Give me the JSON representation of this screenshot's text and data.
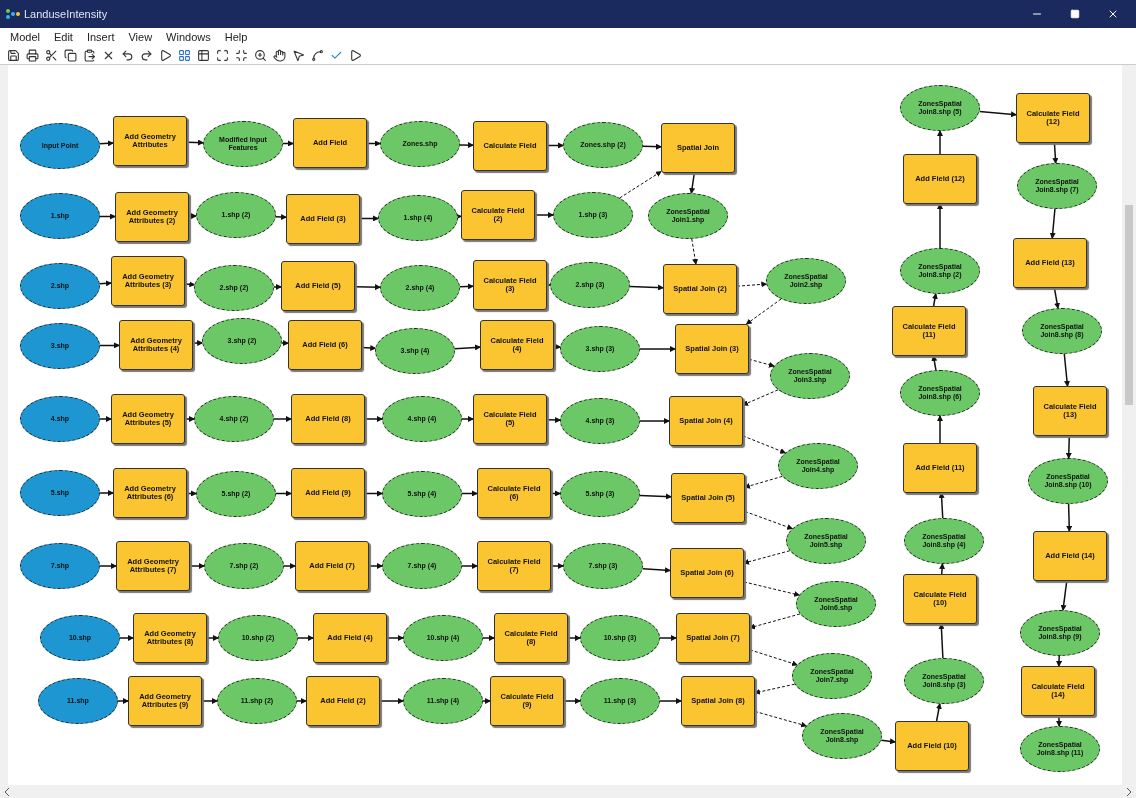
{
  "window": {
    "title": "LanduseIntensity"
  },
  "menu": [
    "Model",
    "Edit",
    "Insert",
    "View",
    "Windows",
    "Help"
  ],
  "canvas": {
    "rows": [
      {
        "nodes": [
          {
            "kind": "input",
            "label": "Input Point"
          },
          {
            "kind": "tool",
            "label": "Add Geometry Attributes"
          },
          {
            "kind": "output",
            "label": "Modified Input Features"
          },
          {
            "kind": "tool",
            "label": "Add Field"
          },
          {
            "kind": "output",
            "label": "Zones.shp"
          },
          {
            "kind": "tool",
            "label": "Calculate Field"
          },
          {
            "kind": "output",
            "label": "Zones.shp (2)"
          },
          {
            "kind": "tool",
            "label": "Spatial Join"
          }
        ]
      },
      {
        "nodes": [
          {
            "kind": "input",
            "label": "1.shp"
          },
          {
            "kind": "tool",
            "label": "Add Geometry Attributes (2)"
          },
          {
            "kind": "output",
            "label": "1.shp (2)"
          },
          {
            "kind": "tool",
            "label": "Add Field (3)"
          },
          {
            "kind": "output",
            "label": "1.shp (4)"
          },
          {
            "kind": "tool",
            "label": "Calculate Field (2)"
          },
          {
            "kind": "output",
            "label": "1.shp (3)"
          },
          {
            "kind": "output",
            "label": "ZonesSpatial Join1.shp"
          }
        ]
      },
      {
        "nodes": [
          {
            "kind": "input",
            "label": "2.shp"
          },
          {
            "kind": "tool",
            "label": "Add Geometry Attributes (3)"
          },
          {
            "kind": "output",
            "label": "2.shp (2)"
          },
          {
            "kind": "tool",
            "label": "Add Field (5)"
          },
          {
            "kind": "output",
            "label": "2.shp (4)"
          },
          {
            "kind": "tool",
            "label": "Calculate Field (3)"
          },
          {
            "kind": "output",
            "label": "2.shp (3)"
          },
          {
            "kind": "tool",
            "label": "Spatial Join (2)"
          },
          {
            "kind": "output",
            "label": "ZonesSpatial Join2.shp"
          }
        ]
      },
      {
        "nodes": [
          {
            "kind": "input",
            "label": "3.shp"
          },
          {
            "kind": "tool",
            "label": "Add Geometry Attributes (4)"
          },
          {
            "kind": "output",
            "label": "3.shp (2)"
          },
          {
            "kind": "tool",
            "label": "Add Field (6)"
          },
          {
            "kind": "output",
            "label": "3.shp (4)"
          },
          {
            "kind": "tool",
            "label": "Calculate Field (4)"
          },
          {
            "kind": "output",
            "label": "3.shp (3)"
          },
          {
            "kind": "tool",
            "label": "Spatial Join (3)"
          },
          {
            "kind": "output",
            "label": "ZonesSpatial Join3.shp"
          }
        ]
      },
      {
        "nodes": [
          {
            "kind": "input",
            "label": "4.shp"
          },
          {
            "kind": "tool",
            "label": "Add Geometry Attributes (5)"
          },
          {
            "kind": "output",
            "label": "4.shp (2)"
          },
          {
            "kind": "tool",
            "label": "Add Field (8)"
          },
          {
            "kind": "output",
            "label": "4.shp (4)"
          },
          {
            "kind": "tool",
            "label": "Calculate Field (5)"
          },
          {
            "kind": "output",
            "label": "4.shp (3)"
          },
          {
            "kind": "tool",
            "label": "Spatial Join (4)"
          },
          {
            "kind": "output",
            "label": "ZonesSpatial Join4.shp"
          }
        ]
      },
      {
        "nodes": [
          {
            "kind": "input",
            "label": "5.shp"
          },
          {
            "kind": "tool",
            "label": "Add Geometry Attributes (6)"
          },
          {
            "kind": "output",
            "label": "5.shp (2)"
          },
          {
            "kind": "tool",
            "label": "Add Field (9)"
          },
          {
            "kind": "output",
            "label": "5.shp (4)"
          },
          {
            "kind": "tool",
            "label": "Calculate Field (6)"
          },
          {
            "kind": "output",
            "label": "5.shp (3)"
          },
          {
            "kind": "tool",
            "label": "Spatial Join (5)"
          },
          {
            "kind": "output",
            "label": "ZonesSpatial Join5.shp"
          }
        ]
      },
      {
        "nodes": [
          {
            "kind": "input",
            "label": "7.shp"
          },
          {
            "kind": "tool",
            "label": "Add Geometry Attributes (7)"
          },
          {
            "kind": "output",
            "label": "7.shp (2)"
          },
          {
            "kind": "tool",
            "label": "Add Field (7)"
          },
          {
            "kind": "output",
            "label": "7.shp (4)"
          },
          {
            "kind": "tool",
            "label": "Calculate Field (7)"
          },
          {
            "kind": "output",
            "label": "7.shp (3)"
          },
          {
            "kind": "tool",
            "label": "Spatial Join (6)"
          },
          {
            "kind": "output",
            "label": "ZonesSpatial Join6.shp"
          }
        ]
      },
      {
        "nodes": [
          {
            "kind": "input",
            "label": "10.shp"
          },
          {
            "kind": "tool",
            "label": "Add Geometry Attributes (8)"
          },
          {
            "kind": "output",
            "label": "10.shp (2)"
          },
          {
            "kind": "tool",
            "label": "Add Field (4)"
          },
          {
            "kind": "output",
            "label": "10.shp (4)"
          },
          {
            "kind": "tool",
            "label": "Calculate Field (8)"
          },
          {
            "kind": "output",
            "label": "10.shp (3)"
          },
          {
            "kind": "tool",
            "label": "Spatial Join (7)"
          },
          {
            "kind": "output",
            "label": "ZonesSpatial Join7.shp"
          }
        ]
      },
      {
        "nodes": [
          {
            "kind": "input",
            "label": "11.shp"
          },
          {
            "kind": "tool",
            "label": "Add Geometry Attributes (9)"
          },
          {
            "kind": "output",
            "label": "11.shp (2)"
          },
          {
            "kind": "tool",
            "label": "Add Field (2)"
          },
          {
            "kind": "output",
            "label": "11.shp (4)"
          },
          {
            "kind": "tool",
            "label": "Calculate Field (9)"
          },
          {
            "kind": "output",
            "label": "11.shp (3)"
          },
          {
            "kind": "tool",
            "label": "Spatial Join (8)"
          },
          {
            "kind": "output",
            "label": "ZonesSpatial Join8.shp"
          }
        ]
      }
    ],
    "columns": [
      {
        "nodes": [
          {
            "kind": "output",
            "label": "ZonesSpatial Join8.shp (5)"
          },
          {
            "kind": "tool",
            "label": "Add Field (12)"
          },
          {
            "kind": "output",
            "label": "ZonesSpatial Join8.shp (2)"
          },
          {
            "kind": "tool",
            "label": "Calculate Field (11)"
          },
          {
            "kind": "output",
            "label": "ZonesSpatial Join8.shp (6)"
          },
          {
            "kind": "tool",
            "label": "Add Field (11)"
          },
          {
            "kind": "output",
            "label": "ZonesSpatial Join8.shp (4)"
          },
          {
            "kind": "tool",
            "label": "Calculate Field (10)"
          },
          {
            "kind": "output",
            "label": "ZonesSpatial Join8.shp (3)"
          },
          {
            "kind": "tool",
            "label": "Add Field (10)"
          }
        ]
      },
      {
        "nodes": [
          {
            "kind": "tool",
            "label": "Calculate Field (12)"
          },
          {
            "kind": "output",
            "label": "ZonesSpatial Join8.shp (7)"
          },
          {
            "kind": "tool",
            "label": "Add Field (13)"
          },
          {
            "kind": "output",
            "label": "ZonesSpatial Join8.shp (8)"
          },
          {
            "kind": "tool",
            "label": "Calculate Field (13)"
          },
          {
            "kind": "output",
            "label": "ZonesSpatial Join8.shp (10)"
          },
          {
            "kind": "tool",
            "label": "Add Field (14)"
          },
          {
            "kind": "output",
            "label": "ZonesSpatial Join8.shp (9)"
          },
          {
            "kind": "tool",
            "label": "Calculate Field (14)"
          },
          {
            "kind": "output",
            "label": "ZonesSpatial Join8.shp (11)"
          }
        ]
      }
    ]
  }
}
